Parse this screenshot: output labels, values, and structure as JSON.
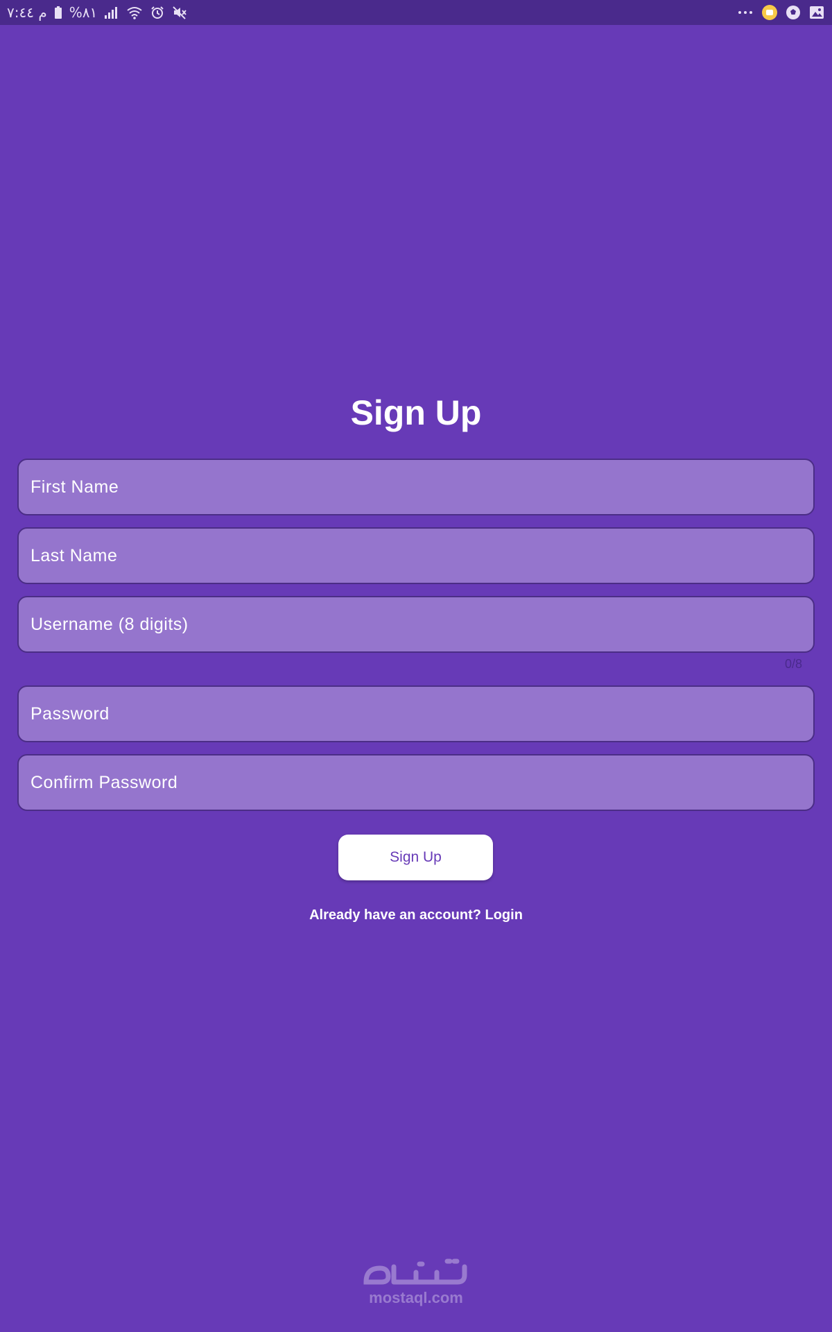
{
  "status_bar": {
    "time": "م ٧:٤٤",
    "battery": "%٨١",
    "icons_left": [
      "battery-icon",
      "signal-icon",
      "wifi-icon",
      "alarm-icon",
      "mute-icon"
    ],
    "icons_right": [
      "more-icon",
      "notification-app-icon",
      "ball-app-icon",
      "gallery-icon"
    ]
  },
  "form": {
    "title": "Sign Up",
    "fields": [
      {
        "label": "First Name"
      },
      {
        "label": "Last Name"
      },
      {
        "label": "Username (8 digits)",
        "counter": "0/8"
      },
      {
        "label": "Password"
      },
      {
        "label": "Confirm Password"
      }
    ],
    "submit_label": "Sign Up",
    "login_prompt": "Already have an account? Login"
  },
  "watermark": {
    "text": "mostaql.com",
    "arabic": "مستقل"
  },
  "colors": {
    "background": "#673ab7",
    "status_bar": "#4a2a8c",
    "field_fill": "#9575cd",
    "field_border": "#4b2d86",
    "button": "#ffffff",
    "button_text": "#673ab7"
  }
}
